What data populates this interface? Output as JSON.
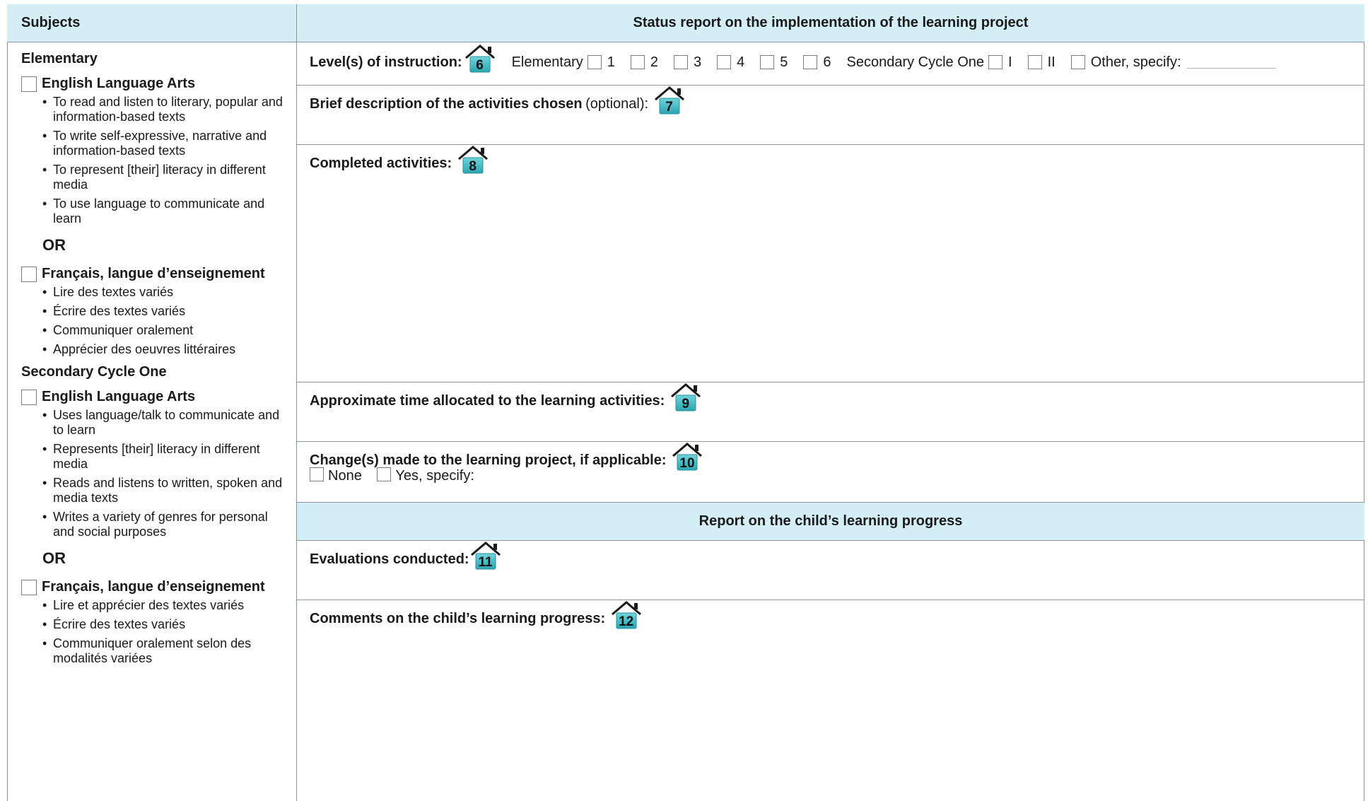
{
  "headers": {
    "subjects": "Subjects",
    "status_report": "Status report on the implementation of the learning project",
    "progress_report": "Report on the child’s learning progress"
  },
  "left": {
    "elementary_title": "Elementary",
    "elem_ela": {
      "label": "English Language Arts",
      "items": [
        "To read and listen to literary, popular and information-based texts",
        "To write self-expressive, narrative and information-based texts",
        "To represent [their] literacy in different media",
        "To use language to communicate and learn"
      ]
    },
    "or1": "OR",
    "elem_fr": {
      "label": "Français, langue d’enseignement",
      "items": [
        "Lire des textes variés",
        "Écrire des textes variés",
        "Communiquer oralement",
        "Apprécier des oeuvres littéraires"
      ]
    },
    "secondary_title": "Secondary Cycle One",
    "sec_ela": {
      "label": "English Language Arts",
      "items": [
        "Uses language/talk to communicate and to learn",
        "Represents [their] literacy in different media",
        "Reads and listens to written, spoken and media texts",
        "Writes a variety of genres for personal and social purposes"
      ]
    },
    "or2": "OR",
    "sec_fr": {
      "label": "Français, langue d’enseignement",
      "items": [
        "Lire et apprécier des textes variés",
        "Écrire des textes variés",
        "Communiquer oralement selon des modalités variées"
      ]
    }
  },
  "levels": {
    "label": "Level(s) of instruction:",
    "icon_number": "6",
    "elementary": "Elementary",
    "elem_options": [
      "1",
      "2",
      "3",
      "4",
      "5",
      "6"
    ],
    "secondary": "Secondary Cycle One",
    "sec_options": [
      "I",
      "II"
    ],
    "other": "Other, specify:"
  },
  "brief": {
    "label": "Brief description of the activities chosen",
    "optional": "(optional):",
    "icon_number": "7"
  },
  "completed": {
    "label": "Completed activities:",
    "icon_number": "8"
  },
  "time": {
    "label": "Approximate time allocated to the learning activities:",
    "icon_number": "9"
  },
  "changes": {
    "label": "Change(s) made to the learning project, if applicable:",
    "icon_number": "10",
    "none": "None",
    "yes": "Yes, specify:"
  },
  "evaluations": {
    "label": "Evaluations conducted:",
    "icon_number": "11"
  },
  "comments": {
    "label": "Comments on the child’s learning progress:",
    "icon_number": "12"
  },
  "colors": {
    "header_bg": "#d3eef5",
    "icon_teal": "#3fb9c4",
    "border": "#8a969c"
  }
}
